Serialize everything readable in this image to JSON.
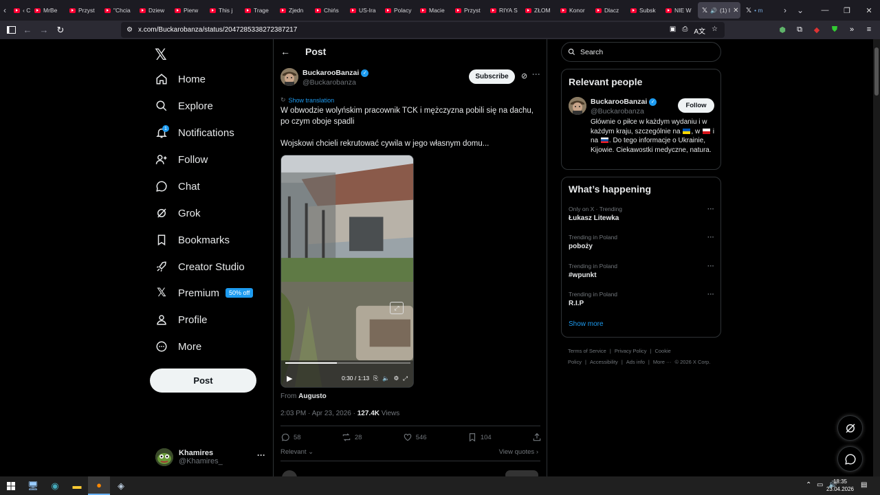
{
  "browser": {
    "tabs": [
      {
        "label": "‹ C",
        "icon": "youtube-icon"
      },
      {
        "label": "MrBe",
        "icon": "youtube-icon"
      },
      {
        "label": "Przyst",
        "icon": "youtube-icon"
      },
      {
        "label": "\"Chcia",
        "icon": "youtube-icon"
      },
      {
        "label": "Dziew",
        "icon": "youtube-icon"
      },
      {
        "label": "Pierw",
        "icon": "youtube-icon"
      },
      {
        "label": "This j",
        "icon": "youtube-icon"
      },
      {
        "label": "Trage",
        "icon": "youtube-icon"
      },
      {
        "label": "Zjedn",
        "icon": "youtube-icon"
      },
      {
        "label": "Chińs",
        "icon": "youtube-icon"
      },
      {
        "label": "US-Ira",
        "icon": "youtube-icon"
      },
      {
        "label": "Polacy",
        "icon": "youtube-icon"
      },
      {
        "label": "Macie",
        "icon": "youtube-icon"
      },
      {
        "label": "Przyst",
        "icon": "youtube-icon"
      },
      {
        "label": "RIYA S",
        "icon": "youtube-icon"
      },
      {
        "label": "ZŁOM",
        "icon": "youtube-icon"
      },
      {
        "label": "Konor",
        "icon": "youtube-icon"
      },
      {
        "label": "Dlacz",
        "icon": "youtube-icon"
      },
      {
        "label": "Subsk",
        "icon": "youtube-icon"
      },
      {
        "label": "NIE W",
        "icon": "youtube-icon"
      }
    ],
    "active_tab_label": "(1) I",
    "extra_tab_label": "• m",
    "url": "x.com/Buckarobanza/status/2047285338272387217"
  },
  "nav": {
    "items": [
      {
        "label": "Home",
        "icon": "home-icon"
      },
      {
        "label": "Explore",
        "icon": "search-icon"
      },
      {
        "label": "Notifications",
        "icon": "bell-icon"
      },
      {
        "label": "Follow",
        "icon": "person-add-icon"
      },
      {
        "label": "Chat",
        "icon": "chat-icon"
      },
      {
        "label": "Grok",
        "icon": "grok-icon"
      },
      {
        "label": "Bookmarks",
        "icon": "bookmark-icon"
      },
      {
        "label": "Creator Studio",
        "icon": "rocket-icon"
      },
      {
        "label": "Premium",
        "icon": "x-icon"
      },
      {
        "label": "Profile",
        "icon": "person-icon"
      },
      {
        "label": "More",
        "icon": "more-circle-icon"
      }
    ],
    "notifications_count": "1",
    "premium_badge": "50% off",
    "post_button": "Post",
    "account": {
      "name": "Khamires",
      "handle": "@Khamires_"
    }
  },
  "post": {
    "header": "Post",
    "author": {
      "name": "BuckarooBanzai",
      "handle": "@Buckarobanza"
    },
    "subscribe": "Subscribe",
    "show_translation": "Show translation",
    "text_1": "W obwodzie wolyńskim pracownik TCK i mężczyzna pobili się na dachu, po czym oboje spadli",
    "text_2": "Wojskowi chcieli rekrutować cywila w jego własnym domu...",
    "video": {
      "time": "0:30 / 1:13",
      "progress": 0.41
    },
    "from_label": "From",
    "from_name": "Augusto",
    "timestamp": "2:03 PM · Apr 23, 2026 ·",
    "views_count": "127.4K",
    "views_label": "Views",
    "replies": "58",
    "reposts": "28",
    "likes": "546",
    "bookmarks": "104",
    "relevant": "Relevant",
    "view_quotes": "View quotes"
  },
  "sidebar": {
    "search_placeholder": "Search",
    "relevant_people": {
      "title": "Relevant people",
      "name": "BuckarooBanzai",
      "handle": "@Buckarobanza",
      "follow": "Follow",
      "bio_1": "Głównie o piłce w każdym wydaniu i w każdym kraju, szczególnie na",
      "bio_2": ", w",
      "bio_3": "i na",
      "bio_4": ". Do tego informacje o Ukrainie, Kijowie. Ciekawostki medyczne, natura."
    },
    "happening": {
      "title": "What’s happening",
      "trends": [
        {
          "context": "Only on X · Trending",
          "title": "Łukasz Litewka"
        },
        {
          "context": "Trending in Poland",
          "title": "poboży"
        },
        {
          "context": "Trending in Poland",
          "title": "#wpunkt"
        },
        {
          "context": "Trending in Poland",
          "title": "R.I.P"
        }
      ],
      "show_more": "Show more"
    },
    "footer": [
      "Terms of Service",
      "|",
      "Privacy Policy",
      "|",
      "Cookie Policy",
      "|",
      "Accessibility",
      "|",
      "Ads info",
      "|",
      "More ···",
      "© 2026 X Corp."
    ]
  },
  "taskbar": {
    "time": "18:35",
    "date": "23.04.2026"
  },
  "colors": {
    "accent": "#1d9bf0",
    "bg": "#000000",
    "border": "#2f3336",
    "muted": "#71767b"
  }
}
